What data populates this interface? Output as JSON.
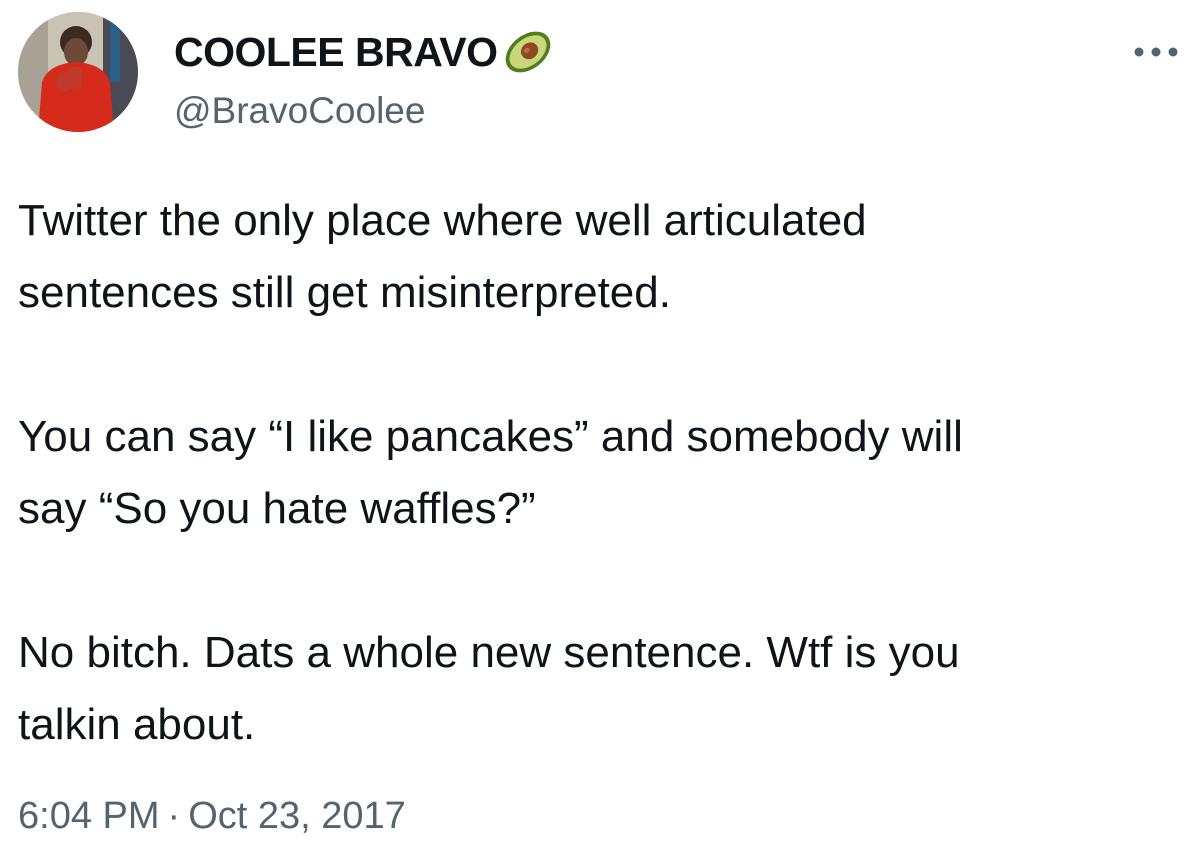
{
  "author": {
    "display_name": "COOLEE BRAVO",
    "emoji_icon": "avocado-icon",
    "handle": "@BravoCoolee",
    "avatar_icon": "profile-photo-person-red-hoodie"
  },
  "menu": {
    "icon": "more-horizontal-icon"
  },
  "tweet": {
    "paragraphs": [
      "Twitter the only place where well articulated\nsentences still get misinterpreted.",
      "You can say “I like pancakes” and somebody will\nsay “So you hate waffles?”",
      "No bitch. Dats a whole new sentence. Wtf is you\ntalkin about."
    ]
  },
  "meta": {
    "time": "6:04 PM",
    "separator": "·",
    "date": "Oct 23, 2017"
  },
  "colors": {
    "text_primary": "#0f1419",
    "text_secondary": "#536471",
    "background": "#ffffff"
  }
}
